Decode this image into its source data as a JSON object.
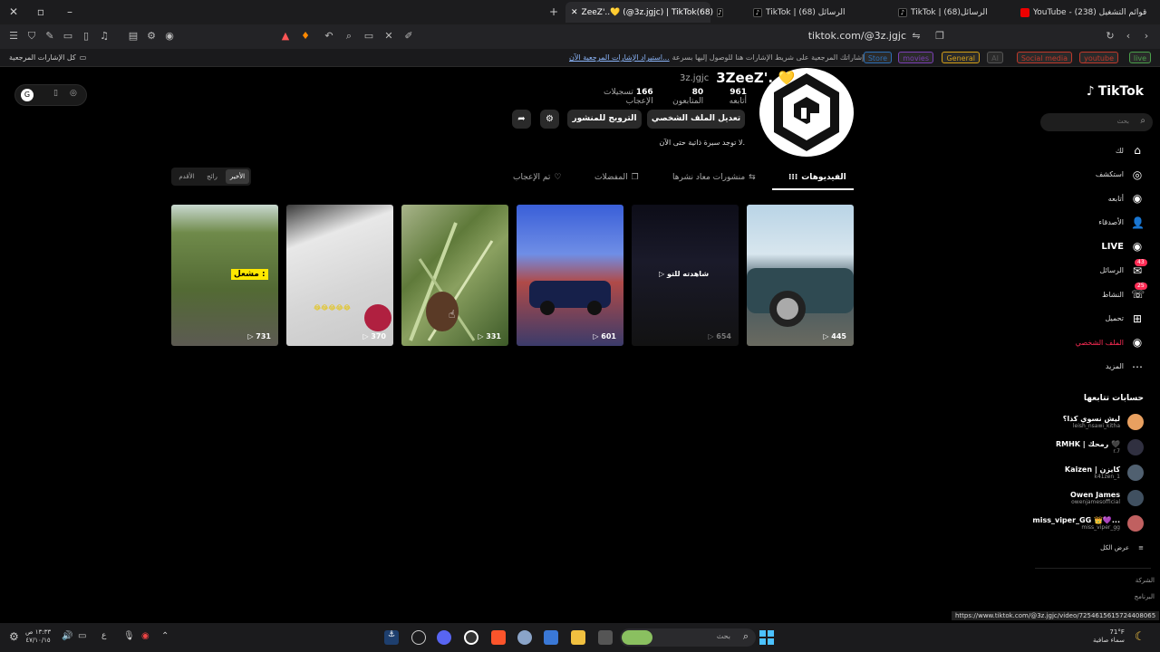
{
  "browser": {
    "tabs": [
      {
        "title": "YouTube - قوائم التشغيل (238)",
        "active": false
      },
      {
        "title": "TikTok | الرسائل(68)",
        "active": false
      },
      {
        "title": "TikTok | الرسائل (68)",
        "active": false
      },
      {
        "title": "ZeeZ'..💛 (@3z.jgjc) | TikTok(68)",
        "active": true
      }
    ],
    "url": "tiktok.com/@3z.jgjc",
    "bookmarks_bar": {
      "all_bookmarks": "كل الإشارات المرجعية",
      "hint": "ضع إشاراتك المرجعية على شريط الإشارات هنا للوصول إليها بسرعة.",
      "import_link": "استيراد الإشارات المرجعية الآن...",
      "chips": [
        {
          "label": "live",
          "color": "#4a9f4a"
        },
        {
          "label": "youtube",
          "color": "#c0392b"
        },
        {
          "label": "Social media",
          "color": "#c0392b"
        },
        {
          "label": "AI",
          "color": "#555555"
        },
        {
          "label": "General",
          "color": "#d4a017"
        },
        {
          "label": "movies",
          "color": "#7b3fb5"
        },
        {
          "label": "Store",
          "color": "#2d6fb5"
        }
      ]
    },
    "status_url": "https://www.tiktok.com/@3z.jgjc/video/7254615615724408065"
  },
  "sidebar": {
    "logo": "TikTok",
    "search_placeholder": "بحث",
    "nav": [
      {
        "label": "لك",
        "icon": "home-icon"
      },
      {
        "label": "استكشف",
        "icon": "compass-icon"
      },
      {
        "label": "أتابعه",
        "icon": "following-icon"
      },
      {
        "label": "الأصدقاء",
        "icon": "friends-icon"
      },
      {
        "label": "LIVE",
        "icon": "live-icon"
      },
      {
        "label": "الرسائل",
        "icon": "messages-icon",
        "badge": "43"
      },
      {
        "label": "النشاط",
        "icon": "activity-icon",
        "badge": "25"
      },
      {
        "label": "تحميل",
        "icon": "upload-icon"
      },
      {
        "label": "الملف الشخصي",
        "icon": "profile-icon"
      },
      {
        "label": "المزيد",
        "icon": "more-icon"
      }
    ],
    "following_title": "حسابات تتابعها",
    "following": [
      {
        "name": "ليش نسوي كذا؟",
        "handle": "leish_nsawi_kitha"
      },
      {
        "name": "RMHK | رمحك 🖤",
        "handle": "r.7"
      },
      {
        "name": "Kaizen | كايزن",
        "handle": "k41zen_1"
      },
      {
        "name": "Owen James",
        "handle": "owenjamesofficial"
      },
      {
        "name": "miss_viper_GG 👑💜...",
        "handle": "miss_viper_gg"
      }
    ],
    "see_all": "عرض الكل",
    "footer": [
      "الشركة",
      "البرنامج"
    ]
  },
  "profile": {
    "display_name": "3ZeeZ'..💛",
    "username": "3z.jgjc",
    "following_count": "961",
    "following_label": "أتابعه",
    "followers_count": "80",
    "followers_label": "المتابعون",
    "likes_count": "166",
    "likes_label": "تسجيلات الإعجاب",
    "edit_button": "تعديل الملف الشخصي",
    "promote_button": "الترويج للمنشور",
    "bio": "لا توجد سيرة ذاتية حتى الآن."
  },
  "content_tabs": [
    {
      "label": "الفيديوهات",
      "active": true
    },
    {
      "label": "منشورات معاد نشرها",
      "active": false
    },
    {
      "label": "المفضلات",
      "active": false
    },
    {
      "label": "تم الإعجاب",
      "active": false
    }
  ],
  "sort_options": [
    {
      "label": "الأخير",
      "active": true
    },
    {
      "label": "رائج",
      "active": false
    },
    {
      "label": "الأقدم",
      "active": false
    }
  ],
  "videos": [
    {
      "views": "445",
      "overlay": ""
    },
    {
      "views": "654",
      "overlay": "شاهدته للتو"
    },
    {
      "views": "601",
      "overlay": ""
    },
    {
      "views": "331",
      "overlay": ""
    },
    {
      "views": "370",
      "overlay": ""
    },
    {
      "views": "731",
      "overlay": "مشعل :"
    }
  ],
  "taskbar": {
    "search_placeholder": "بحث",
    "weather_temp": "71°F",
    "weather_desc": "سماء صافية",
    "time": "١٣:٣٣ ص",
    "date": "٤٧/١٠/١٥",
    "lang": "ع"
  }
}
